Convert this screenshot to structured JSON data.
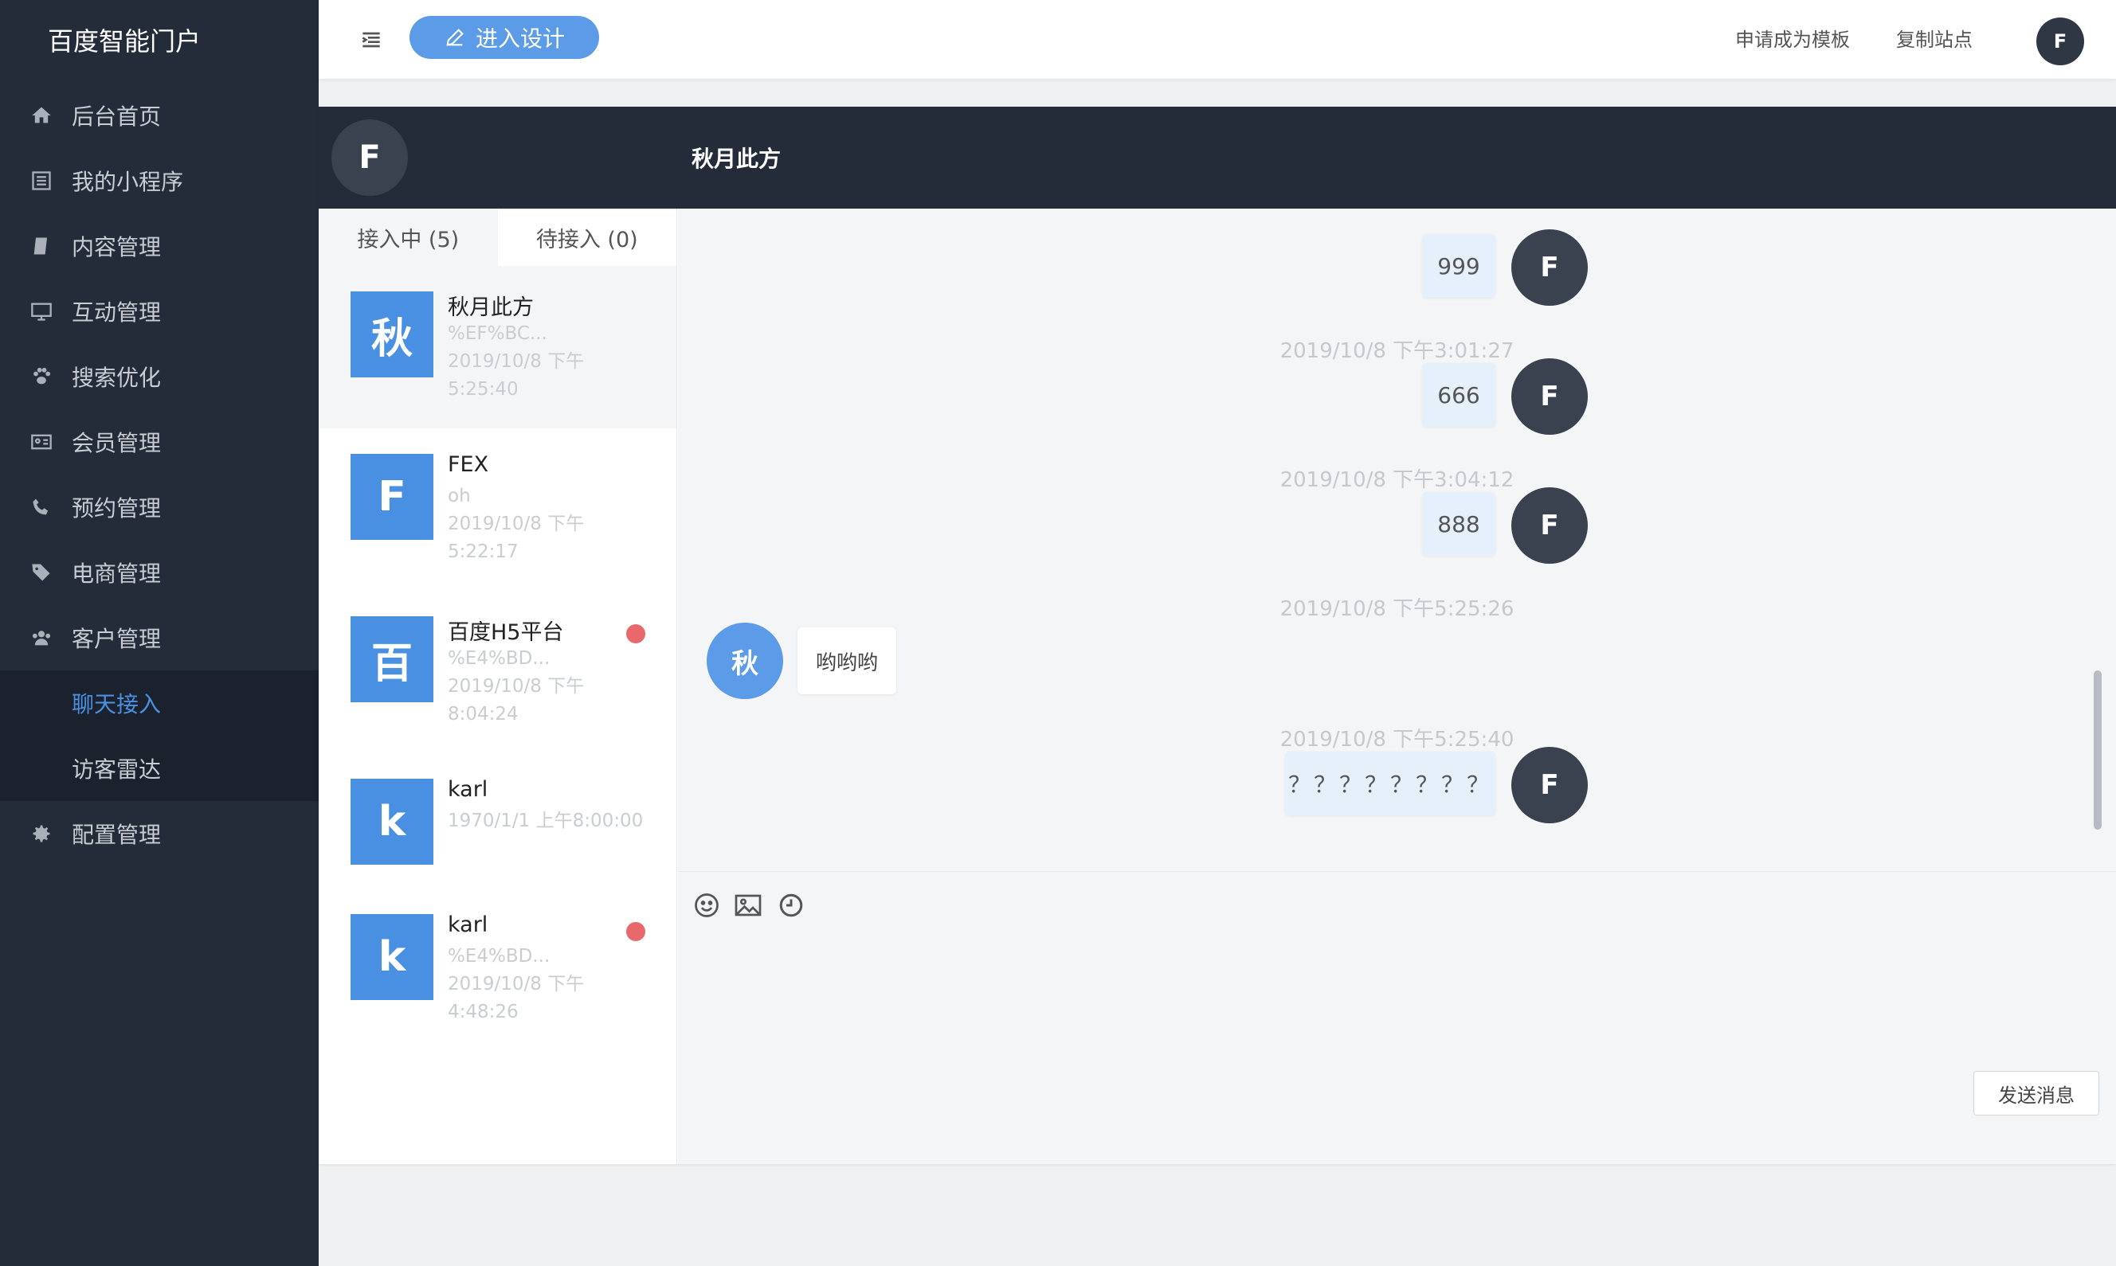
{
  "sidebar": {
    "brand": "百度智能门户",
    "items": [
      {
        "label": "后台首页",
        "icon": "home-icon"
      },
      {
        "label": "我的小程序",
        "icon": "list-icon"
      },
      {
        "label": "内容管理",
        "icon": "book-icon"
      },
      {
        "label": "互动管理",
        "icon": "monitor-icon"
      },
      {
        "label": "搜索优化",
        "icon": "paw-icon"
      },
      {
        "label": "会员管理",
        "icon": "id-card-icon"
      },
      {
        "label": "预约管理",
        "icon": "phone-icon"
      },
      {
        "label": "电商管理",
        "icon": "tags-icon"
      },
      {
        "label": "客户管理",
        "icon": "users-icon"
      }
    ],
    "sub_items": [
      {
        "label": "聊天接入",
        "active": true
      },
      {
        "label": "访客雷达",
        "active": false
      }
    ],
    "config": {
      "label": "配置管理",
      "icon": "gear-icon"
    }
  },
  "header": {
    "design_button": "进入设计",
    "apply_template": "申请成为模板",
    "copy_site": "复制站点",
    "avatar": "F"
  },
  "chat": {
    "header_avatar": "F",
    "header_name": "秋月此方",
    "tabs": [
      {
        "label": "接入中 (5)",
        "active": true
      },
      {
        "label": "待接入 (0)",
        "active": false
      }
    ],
    "conversations": [
      {
        "avatar": "秋",
        "name": "秋月此方",
        "preview": "%EF%BC...",
        "time1": "2019/10/8 下午",
        "time2": "5:25:40",
        "unread": false,
        "selected": true
      },
      {
        "avatar": "F",
        "name": "FEX",
        "preview": "oh",
        "time1": "2019/10/8 下午",
        "time2": "5:22:17",
        "unread": false,
        "selected": false
      },
      {
        "avatar": "百",
        "name": "百度H5平台",
        "preview": "%E4%BD...",
        "time1": "2019/10/8 下午",
        "time2": "8:04:24",
        "unread": true,
        "selected": false
      },
      {
        "avatar": "k",
        "name": "karl",
        "preview": "1970/1/1 上午8:00:00",
        "time1": "",
        "time2": "",
        "unread": false,
        "selected": false
      },
      {
        "avatar": "k",
        "name": "karl",
        "preview": "%E4%BD...",
        "time1": "2019/10/8 下午",
        "time2": "4:48:26",
        "unread": true,
        "selected": false
      }
    ],
    "messages": {
      "m1": {
        "text": "999",
        "avatar": "F"
      },
      "ts1": "2019/10/8 下午3:01:27",
      "m2": {
        "text": "666",
        "avatar": "F"
      },
      "ts2": "2019/10/8 下午3:04:12",
      "m3": {
        "text": "888",
        "avatar": "F"
      },
      "ts3": "2019/10/8 下午5:25:26",
      "m4": {
        "text": "哟哟哟",
        "avatar": "秋"
      },
      "ts4": "2019/10/8 下午5:25:40",
      "m5": {
        "text": "？？？？？？？？",
        "avatar": "F"
      }
    },
    "toolbar_icons": [
      "smile-icon",
      "image-icon",
      "clock-icon"
    ],
    "send_button": "发送消息"
  },
  "colors": {
    "sidebar_bg": "#242c3a",
    "accent": "#4a90e2",
    "unread_dot": "#e8696b",
    "out_bubble": "#e6f0fb"
  }
}
